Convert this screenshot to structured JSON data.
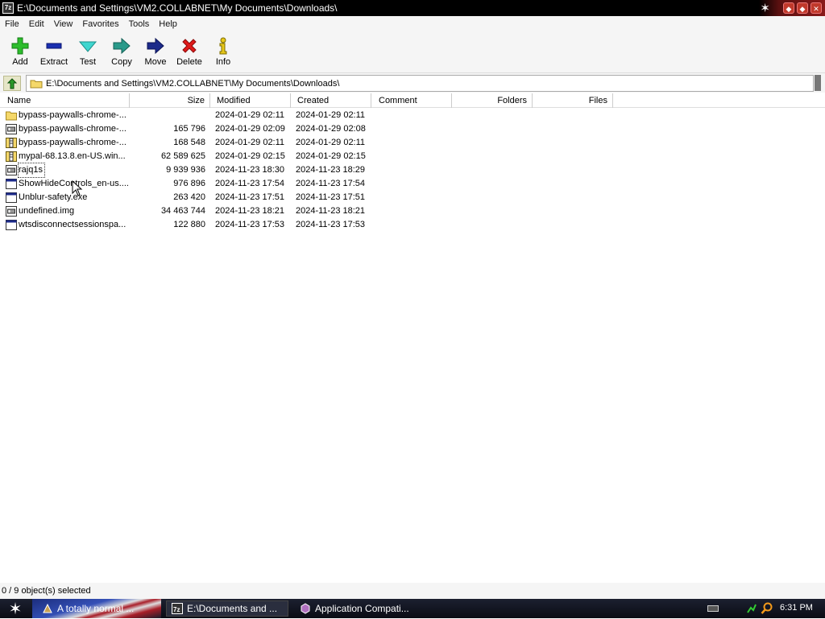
{
  "window": {
    "title": "E:\\Documents and Settings\\VM2.COLLABNET\\My Documents\\Downloads\\",
    "app_icon_text": "7z"
  },
  "menu": [
    "File",
    "Edit",
    "View",
    "Favorites",
    "Tools",
    "Help"
  ],
  "toolbar": {
    "add": "Add",
    "extract": "Extract",
    "test": "Test",
    "copy": "Copy",
    "move": "Move",
    "delete": "Delete",
    "info": "Info"
  },
  "address": {
    "path": "E:\\Documents and Settings\\VM2.COLLABNET\\My Documents\\Downloads\\"
  },
  "columns": {
    "name": "Name",
    "size": "Size",
    "modified": "Modified",
    "created": "Created",
    "comment": "Comment",
    "folders": "Folders",
    "files": "Files"
  },
  "files": [
    {
      "name": "bypass-paywalls-chrome-...",
      "size": "",
      "modified": "2024-01-29 02:11",
      "created": "2024-01-29 02:11",
      "icon": "folder-icon"
    },
    {
      "name": "bypass-paywalls-chrome-...",
      "size": "165 796",
      "modified": "2024-01-29 02:09",
      "created": "2024-01-29 02:08",
      "icon": "disk-image-icon"
    },
    {
      "name": "bypass-paywalls-chrome-...",
      "size": "168 548",
      "modified": "2024-01-29 02:11",
      "created": "2024-01-29 02:11",
      "icon": "zip-icon"
    },
    {
      "name": "mypal-68.13.8.en-US.win...",
      "size": "62 589 625",
      "modified": "2024-01-29 02:15",
      "created": "2024-01-29 02:15",
      "icon": "zip-icon"
    },
    {
      "name": "rajq1s",
      "size": "9 939 936",
      "modified": "2024-11-23 18:30",
      "created": "2024-11-23 18:29",
      "icon": "disk-image-icon"
    },
    {
      "name": "ShowHideControls_en-us....",
      "size": "976 896",
      "modified": "2024-11-23 17:54",
      "created": "2024-11-23 17:54",
      "icon": "window-app-icon"
    },
    {
      "name": "Unblur-safety.exe",
      "size": "263 420",
      "modified": "2024-11-23 17:51",
      "created": "2024-11-23 17:51",
      "icon": "window-app-icon"
    },
    {
      "name": "undefined.img",
      "size": "34 463 744",
      "modified": "2024-11-23 18:21",
      "created": "2024-11-23 18:21",
      "icon": "disk-image-icon"
    },
    {
      "name": "wtsdisconnectsessionspa...",
      "size": "122 880",
      "modified": "2024-11-23 17:53",
      "created": "2024-11-23 17:53",
      "icon": "window-app-icon"
    }
  ],
  "status": {
    "text": "0 / 9 object(s) selected"
  },
  "taskbar": {
    "items": [
      "A totally normal ...",
      "E:\\Documents and ...",
      "Application Compati..."
    ],
    "clock": "6:31 PM"
  }
}
